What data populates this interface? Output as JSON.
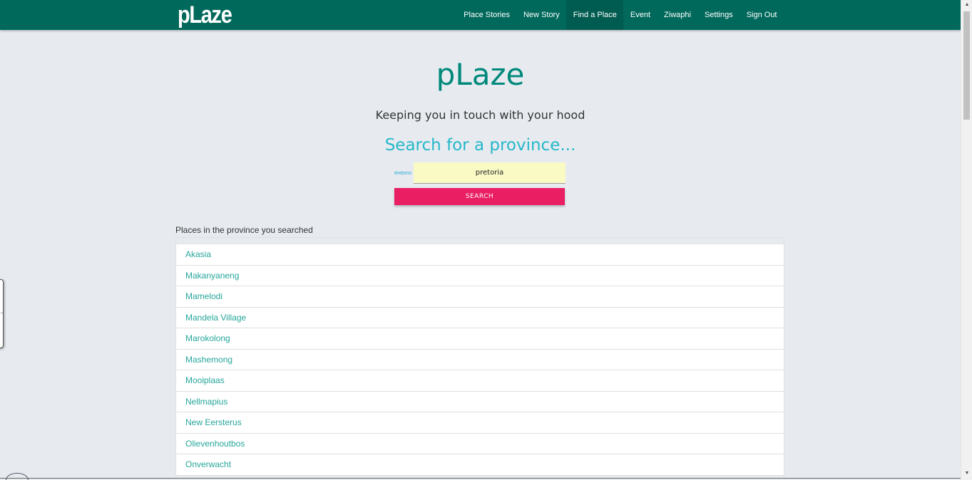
{
  "navbar": {
    "brand": "pLaze",
    "links": [
      {
        "label": "Place Stories",
        "active": false
      },
      {
        "label": "New Story",
        "active": false
      },
      {
        "label": "Find a Place",
        "active": true
      },
      {
        "label": "Event",
        "active": false
      },
      {
        "label": "Ziwaphi",
        "active": false
      },
      {
        "label": "Settings",
        "active": false
      },
      {
        "label": "Sign Out",
        "active": false
      }
    ]
  },
  "hero": {
    "title": "pLaze",
    "tagline": "Keeping you in touch with your hood",
    "search_heading": "Search for a province..."
  },
  "search": {
    "label": "textsms",
    "value": "pretoria",
    "button_label": "SEARCH"
  },
  "results": {
    "heading": "Places in the province you searched",
    "items": [
      "Akasia",
      "Makanyaneng",
      "Mamelodi",
      "Mandela Village",
      "Marokolong",
      "Mashemong",
      "Mooiplaas",
      "Nellmapius",
      "New Eersterus",
      "Olievenhoutbos",
      "Onverwacht"
    ]
  },
  "colors": {
    "navbar": "#00695c",
    "title": "#00897b",
    "search_heading": "#26b7c9",
    "button": "#e91e63",
    "input_bg": "#fafac5",
    "link": "#26a69a",
    "page_bg": "#e7ebf0"
  },
  "icons": {
    "scroll_up": "scroll-up-arrow-icon",
    "scroll_down": "scroll-down-arrow-icon"
  }
}
